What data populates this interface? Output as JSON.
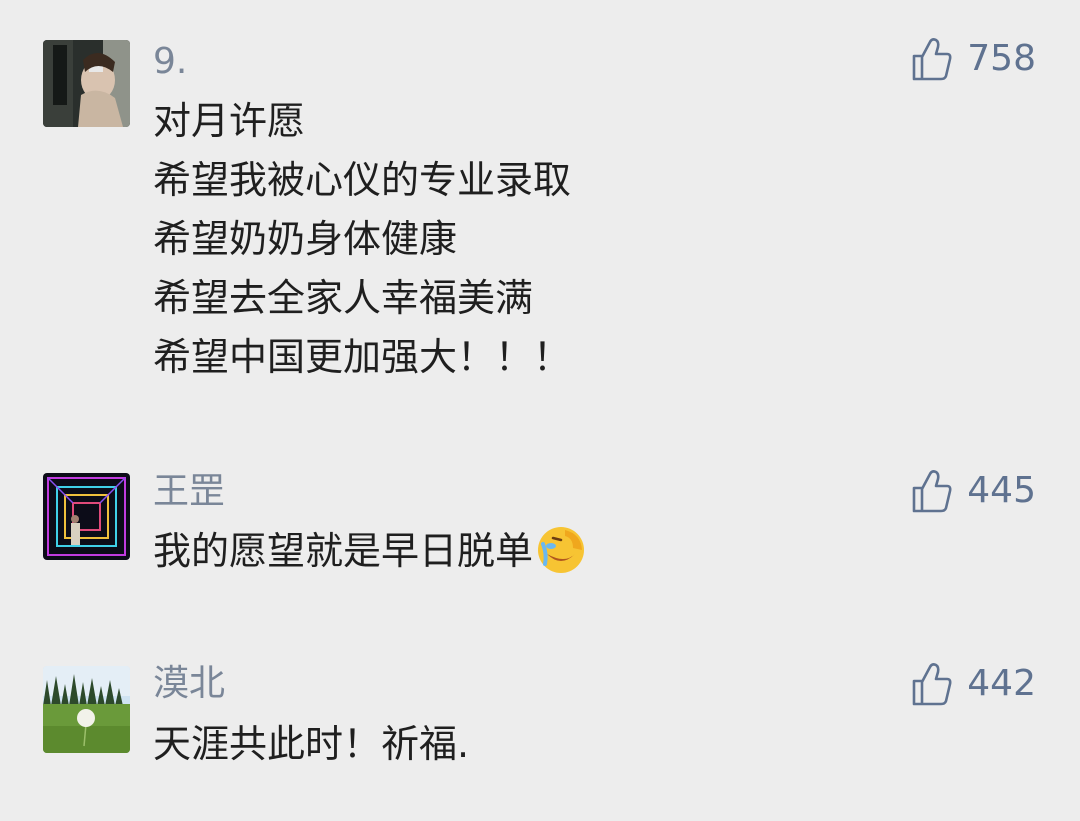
{
  "comments": [
    {
      "username": "9.",
      "likes": "758",
      "lines": [
        "对月许愿",
        "希望我被心仪的专业录取",
        "希望奶奶身体健康",
        "希望去全家人幸福美满",
        "希望中国更加强大！！！"
      ],
      "avatar_icon": "avatar-photo-selfie",
      "like_icon": "thumbs-up-icon"
    },
    {
      "username": "王罡",
      "likes": "445",
      "lines": [
        "我的愿望就是早日脱单"
      ],
      "emoji_icon": "facepalm-crying-emoji",
      "avatar_icon": "avatar-photo-neon-tunnel",
      "like_icon": "thumbs-up-icon"
    },
    {
      "username": "漠北",
      "likes": "442",
      "lines": [
        "天涯共此时！祈福."
      ],
      "avatar_icon": "avatar-photo-dandelion-field",
      "like_icon": "thumbs-up-icon"
    }
  ],
  "colors": {
    "background": "#ededed",
    "username": "#7a8698",
    "like": "#5f7290",
    "text": "#1f1f1f"
  }
}
